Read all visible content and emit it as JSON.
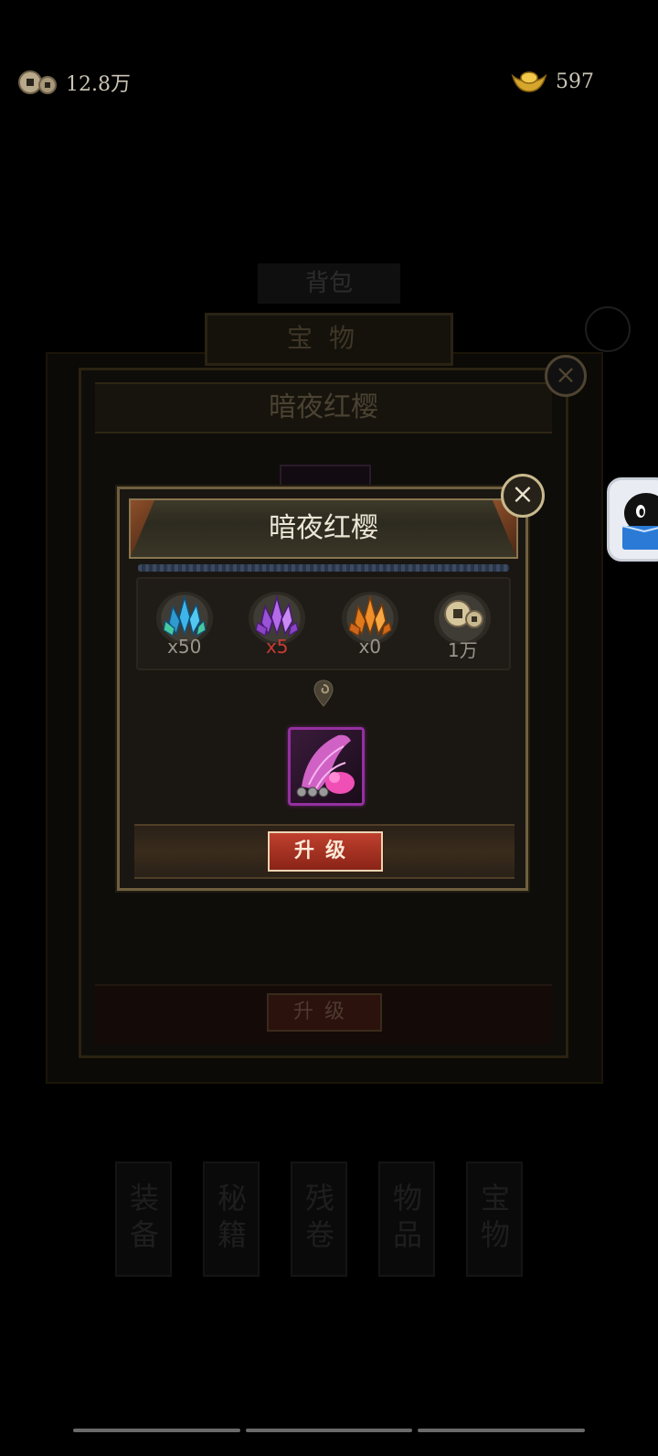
{
  "currency": {
    "copper": "12.8万",
    "gold": "597"
  },
  "background": {
    "top_tab": "背包",
    "tab": "宝物",
    "title": "暗夜红樱",
    "upgrade": "升级",
    "categories": [
      "装备",
      "秘籍",
      "残卷",
      "物品",
      "宝物"
    ]
  },
  "dialog": {
    "title": "暗夜红樱",
    "materials": [
      {
        "icon": "blue-crystal-icon",
        "quantity": "x50"
      },
      {
        "icon": "purple-crystal-icon",
        "quantity": "x5"
      },
      {
        "icon": "orange-crystal-icon",
        "quantity": "x0"
      },
      {
        "icon": "copper-coin-icon",
        "quantity": "1万"
      }
    ],
    "upgrade_label": "升级",
    "item_icon": "pink-wing-icon"
  },
  "colors": {
    "insufficient": "#c83a32",
    "normal_qty": "#9a968c",
    "button": "#b2382a"
  }
}
